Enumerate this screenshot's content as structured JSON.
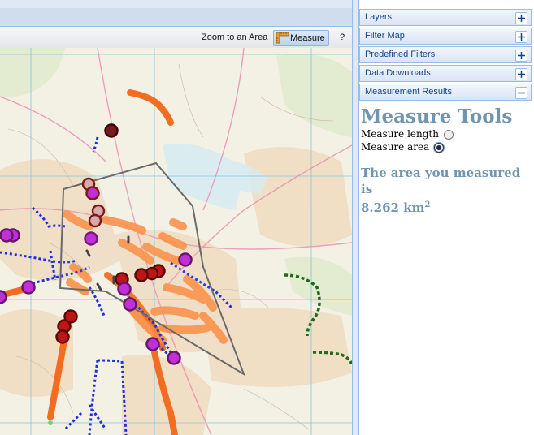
{
  "toolbar": {
    "zoom_label": "Zoom to an Area",
    "measure_label": "Measure",
    "help_label": "?"
  },
  "accordion": [
    {
      "label": "Layers",
      "icon": "plus-icon"
    },
    {
      "label": "Filter Map",
      "icon": "plus-icon"
    },
    {
      "label": "Predefined Filters",
      "icon": "plus-icon"
    },
    {
      "label": "Data Downloads",
      "icon": "plus-icon"
    },
    {
      "label": "Measurement Results",
      "icon": "minus-icon"
    }
  ],
  "measure": {
    "title": "Measure Tools",
    "length_label": "Measure length",
    "area_label": "Measure area",
    "selected": "area",
    "result_text": "The area you measured is",
    "result_value": "8.262 km",
    "result_sup": "2"
  },
  "colors": {
    "accent": "#6f95b0",
    "header_text": "#15428b",
    "route_orange": "#f26d21",
    "route_light_orange": "#fb8c42",
    "blue_dotted": "#1e2ee6",
    "green_dotted": "#1c6b1c",
    "marker_purple": "#c02fd8",
    "marker_red": "#c01515",
    "marker_brown": "#7a1a1a",
    "polygon": "#6a6a6a"
  }
}
